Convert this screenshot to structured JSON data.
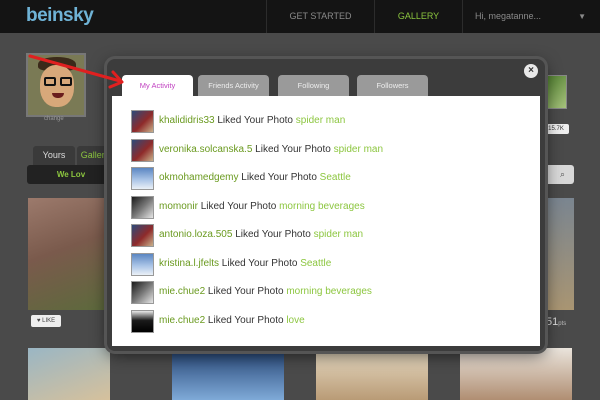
{
  "header": {
    "logo_text": "beinsky",
    "nav": [
      {
        "label": "GET STARTED"
      },
      {
        "label": "GALLERY"
      },
      {
        "label": "Hi, megatanne..."
      }
    ]
  },
  "profile": {
    "name": "change"
  },
  "background": {
    "tabs": [
      {
        "label": "Yours"
      },
      {
        "label": "Gallery"
      }
    ],
    "subbar_label": "We Lov",
    "stat_badge": "15.7K",
    "like_label": "LIKE",
    "points_value": "51",
    "points_unit": "pts"
  },
  "modal": {
    "tabs": [
      {
        "label": "My Activity",
        "active": true
      },
      {
        "label": "Friends Activity",
        "active": false
      },
      {
        "label": "Following",
        "active": false
      },
      {
        "label": "Followers",
        "active": false
      }
    ],
    "close_glyph": "×",
    "activity": [
      {
        "user": "khalididris33",
        "action": "Liked Your Photo",
        "photo": "spider man",
        "thumb": "spider"
      },
      {
        "user": "veronika.solcanska.5",
        "action": "Liked Your Photo",
        "photo": "spider man",
        "thumb": "spider"
      },
      {
        "user": "okmohamedgemy",
        "action": "Liked Your Photo",
        "photo": "Seattle",
        "thumb": "seattle"
      },
      {
        "user": "momonir",
        "action": "Liked Your Photo",
        "photo": "morning beverages",
        "thumb": "morning"
      },
      {
        "user": "antonio.loza.505",
        "action": "Liked Your Photo",
        "photo": "spider man",
        "thumb": "spider"
      },
      {
        "user": "kristina.l.jfelts",
        "action": "Liked Your Photo",
        "photo": "Seattle",
        "thumb": "seattle"
      },
      {
        "user": "mie.chue2",
        "action": "Liked Your Photo",
        "photo": "morning beverages",
        "thumb": "morning"
      },
      {
        "user": "mie.chue2",
        "action": "Liked Your Photo",
        "photo": "love",
        "thumb": "love"
      }
    ]
  },
  "colors": {
    "accent_green": "#8cc63f",
    "active_tab_text": "#c03fc0",
    "annotation_arrow": "#e02020"
  },
  "icons": {
    "close": "close-icon",
    "search": "search-icon",
    "arrow": "red-arrow-annotation"
  }
}
